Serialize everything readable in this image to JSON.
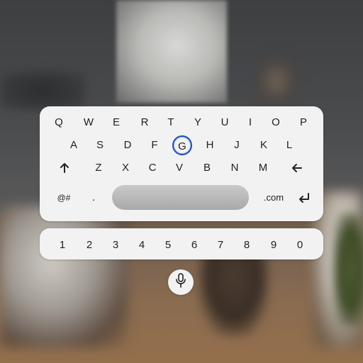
{
  "keyboard": {
    "row1": [
      "Q",
      "W",
      "E",
      "R",
      "T",
      "Y",
      "U",
      "I",
      "O",
      "P"
    ],
    "row2": [
      "A",
      "S",
      "D",
      "F",
      "G",
      "H",
      "J",
      "K",
      "L"
    ],
    "row3": [
      "Z",
      "X",
      "C",
      "V",
      "B",
      "N",
      "M"
    ],
    "symbols_label": "@#",
    "period_label": ".",
    "dotcom_label": ".com",
    "focused_key": "G",
    "icons": {
      "shift": "arrow-up-icon",
      "backspace": "arrow-left-icon",
      "enter": "enter-return-icon",
      "voice": "microphone-icon"
    },
    "accent_color": "#1f4fb0"
  },
  "number_row": [
    "1",
    "2",
    "3",
    "4",
    "5",
    "6",
    "7",
    "8",
    "9",
    "0"
  ]
}
